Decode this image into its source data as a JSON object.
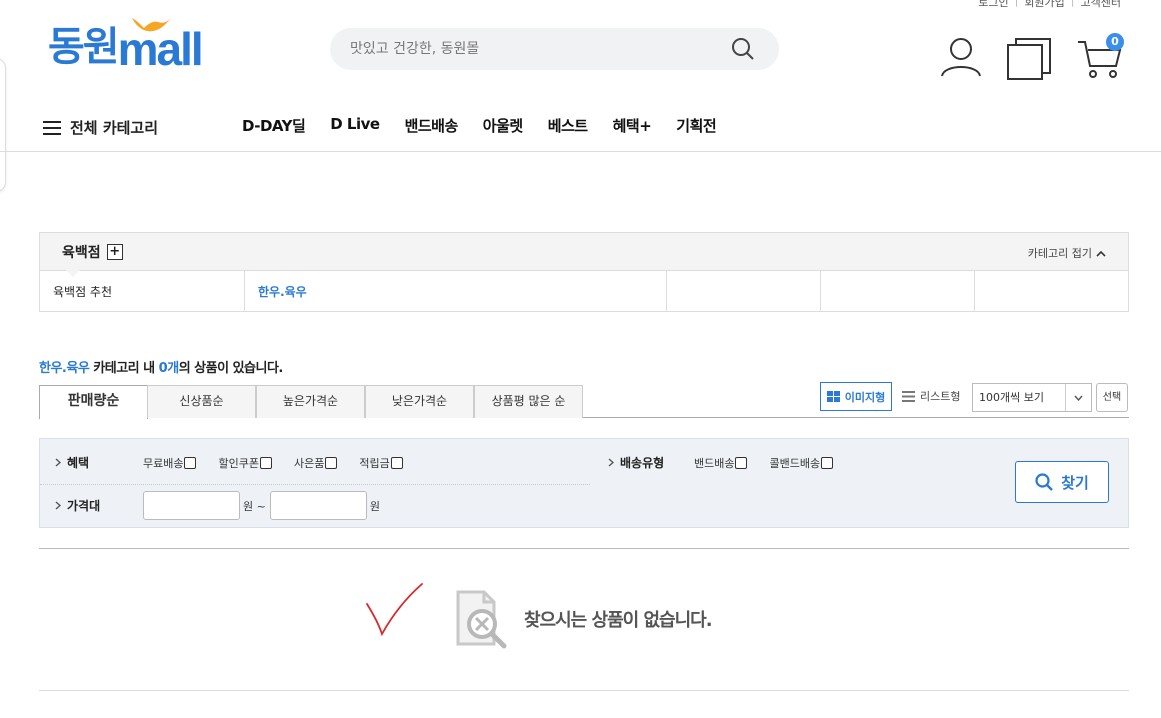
{
  "util_links": [
    "로그인",
    "회원가입",
    "고객센터"
  ],
  "logo": {
    "ko": "동원",
    "en": "mall"
  },
  "search": {
    "placeholder": "맛있고 건강한, 동원몰"
  },
  "cart": {
    "count": "0"
  },
  "nav": {
    "all_category": "전체 카테고리",
    "items": [
      "D-DAY딜",
      "D Live",
      "밴드배송",
      "아울렛",
      "베스트",
      "혜택+",
      "기획전"
    ]
  },
  "category": {
    "title": "육백점",
    "fold_label": "카테고리 접기",
    "row": [
      "육백점 추천",
      "한우.육우",
      "",
      "",
      ""
    ]
  },
  "result": {
    "category": "한우.육우",
    "mid": " 카테고리 내 ",
    "count": "0개",
    "tail": "의 상품이 있습니다."
  },
  "sort_tabs": [
    "판매량순",
    "신상품순",
    "높은가격순",
    "낮은가격순",
    "상품평 많은 순"
  ],
  "view": {
    "image_label": "이미지형",
    "list_label": "리스트형",
    "per_page": "100개씩 보기",
    "select_label": "선택"
  },
  "filter": {
    "benefit_label": "혜택",
    "benefit_options": [
      "무료배송",
      "할인쿠폰",
      "사은품",
      "적립금"
    ],
    "delivery_label": "배송유형",
    "delivery_options": [
      "밴드배송",
      "콜밴드배송"
    ],
    "price_label": "가격대",
    "won1": "원 ~",
    "won2": "원",
    "find_label": "찾기"
  },
  "empty_message": "찾으시는 상품이 없습니다.",
  "colors": {
    "brand_blue": "#2a7ad5",
    "badge_blue": "#3b8fe8",
    "logo_orange": "#f6a623"
  }
}
